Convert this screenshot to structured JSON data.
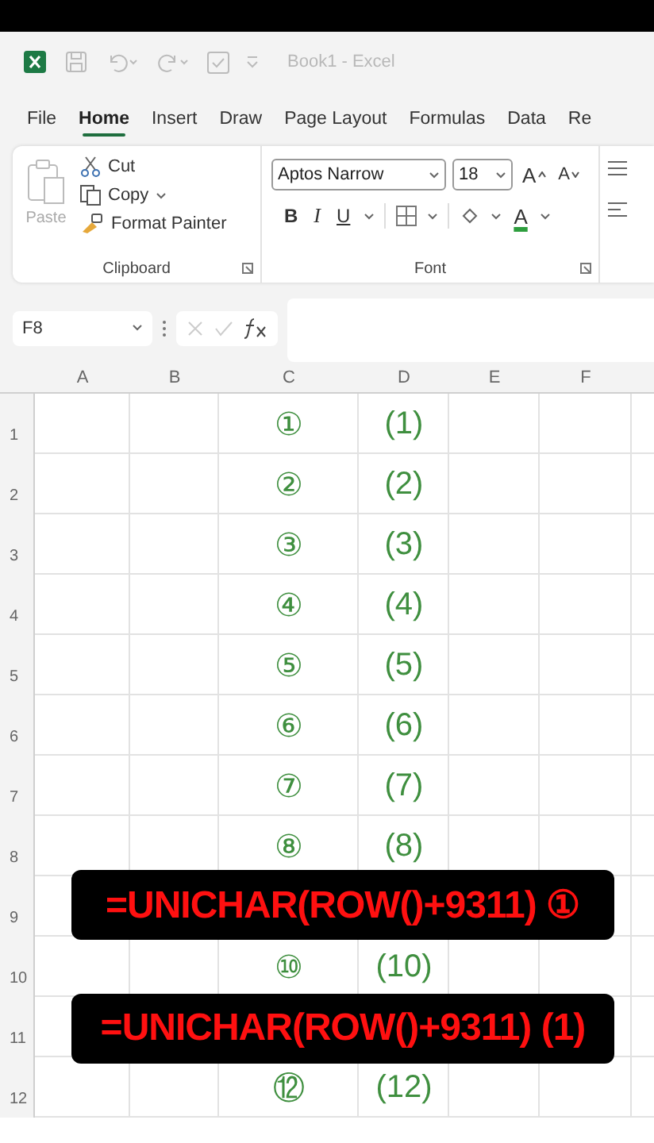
{
  "window": {
    "title": "Book1 - Excel"
  },
  "tabs": [
    {
      "label": "File",
      "selected": false
    },
    {
      "label": "Home",
      "selected": true
    },
    {
      "label": "Insert",
      "selected": false
    },
    {
      "label": "Draw",
      "selected": false
    },
    {
      "label": "Page Layout",
      "selected": false
    },
    {
      "label": "Formulas",
      "selected": false
    },
    {
      "label": "Data",
      "selected": false
    },
    {
      "label": "Re",
      "selected": false
    }
  ],
  "clipboard": {
    "paste": {
      "label": "Paste",
      "disabled": true
    },
    "cut": "Cut",
    "copy": "Copy",
    "format_painter": "Format Painter",
    "group_label": "Clipboard"
  },
  "font": {
    "name": "Aptos Narrow",
    "size": "18",
    "grow": "A",
    "shrink": "A",
    "bold": "B",
    "italic": "I",
    "underline": "U",
    "font_color": "A",
    "group_label": "Font"
  },
  "formula_bar": {
    "name_box": "F8"
  },
  "columns": [
    "A",
    "B",
    "C",
    "D",
    "E",
    "F"
  ],
  "rows": [
    {
      "number": "1",
      "c": "①",
      "d": "(1)"
    },
    {
      "number": "2",
      "c": "②",
      "d": "(2)"
    },
    {
      "number": "3",
      "c": "③",
      "d": "(3)"
    },
    {
      "number": "4",
      "c": "④",
      "d": "(4)"
    },
    {
      "number": "5",
      "c": "⑤",
      "d": "(5)"
    },
    {
      "number": "6",
      "c": "⑥",
      "d": "(6)"
    },
    {
      "number": "7",
      "c": "⑦",
      "d": "(7)"
    },
    {
      "number": "8",
      "c": "⑧",
      "d": "(8)"
    },
    {
      "number": "9"
    },
    {
      "number": "10",
      "c": "⑩",
      "d": "(10)"
    },
    {
      "number": "11"
    },
    {
      "number": "12",
      "c": "⑫",
      "d": "(12)"
    }
  ],
  "captions": [
    {
      "text": "=UNICHAR(ROW()+9311) ①"
    },
    {
      "text": "=UNICHAR(ROW()+9311) (1)"
    }
  ]
}
